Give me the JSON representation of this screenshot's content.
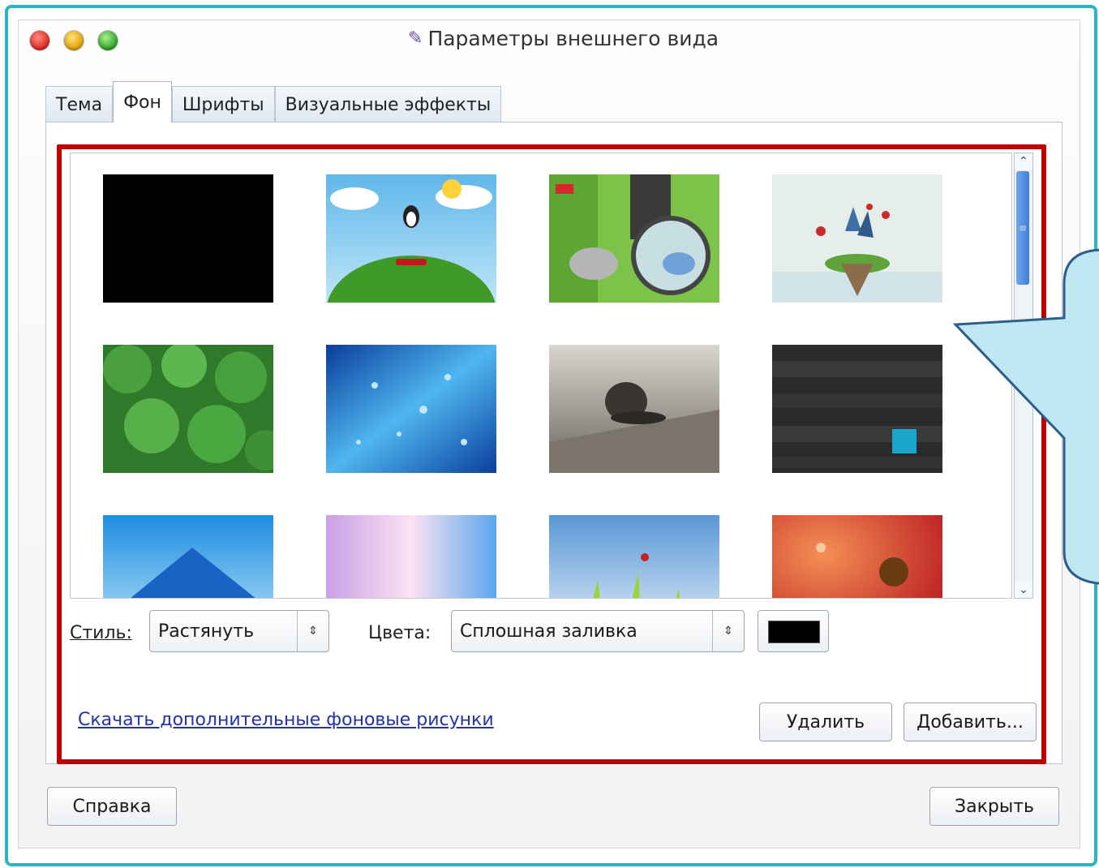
{
  "window": {
    "title": "Параметры внешнего вида"
  },
  "tabs": [
    {
      "label": "Тема",
      "active": false
    },
    {
      "label": "Фон",
      "active": true
    },
    {
      "label": "Шрифты",
      "active": false
    },
    {
      "label": "Визуальные эффекты",
      "active": false
    }
  ],
  "gallery": {
    "thumbnails": [
      "black-wallpaper",
      "penguin-clouds-wallpaper",
      "snail-robot-wallpaper",
      "floating-island-wallpaper",
      "green-leaves-wallpaper",
      "blue-water-drops-wallpaper",
      "snail-on-wood-wallpaper",
      "dark-wood-wallpaper",
      "blue-peak-wallpaper",
      "pink-light-wallpaper",
      "ladybug-grass-wallpaper",
      "red-drops-wallpaper"
    ]
  },
  "controls": {
    "style_label": "Стиль:",
    "style_value": "Растянуть",
    "colors_label": "Цвета:",
    "colors_value": "Сплошная заливка",
    "color_swatch": "#000000"
  },
  "links": {
    "download": "Скачать дополнительные фоновые рисунки"
  },
  "buttons": {
    "delete": "Удалить",
    "add": "Добавить...",
    "help": "Справка",
    "close": "Закрыть"
  },
  "colors": {
    "frame": "#2bb3c6",
    "highlight": "#c00000",
    "callout": "#bfe8f2"
  }
}
